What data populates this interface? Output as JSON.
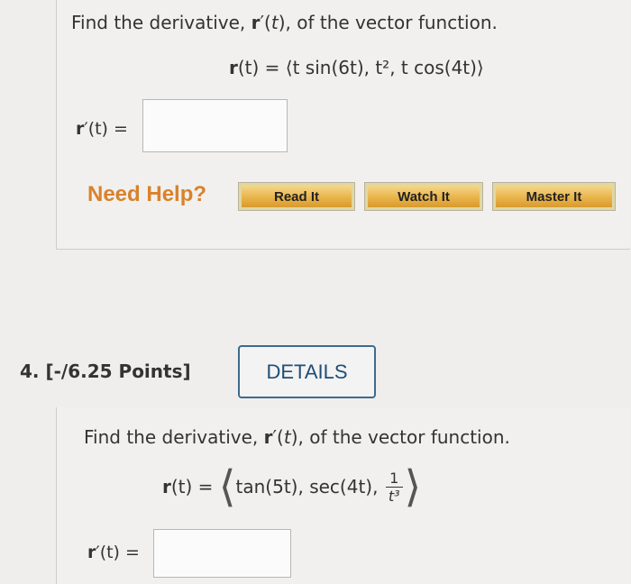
{
  "q3": {
    "prompt_pre": "Find the derivative, ",
    "prompt_bold": "r",
    "prompt_mid": "′(",
    "prompt_t": "t",
    "prompt_post": "), of the vector function.",
    "formula_lhs_r": "r",
    "formula_lhs_rest": "(t) = ",
    "formula_rhs": "⟨t sin(6t), t², t cos(4t)⟩",
    "answer_label_r": "r",
    "answer_label_rest": "′(t) =",
    "answer_value": ""
  },
  "help": {
    "need_help": "Need Help?",
    "read_it": "Read It",
    "watch_it": "Watch It",
    "master_it": "Master It"
  },
  "q4": {
    "number_points": "4.  [-/6.25 Points]",
    "details": "DETAILS",
    "prompt_pre": "Find the derivative, ",
    "prompt_bold": "r",
    "prompt_mid": "′(",
    "prompt_t": "t",
    "prompt_post": "), of the vector function.",
    "formula_lhs_r": "r",
    "formula_lhs_rest": "(t) =",
    "formula_rhs_main": "tan(5t), sec(4t),",
    "frac_num": "1",
    "frac_den": "t³",
    "answer_label_r": "r",
    "answer_label_rest": "′(t) =",
    "answer_value": ""
  }
}
